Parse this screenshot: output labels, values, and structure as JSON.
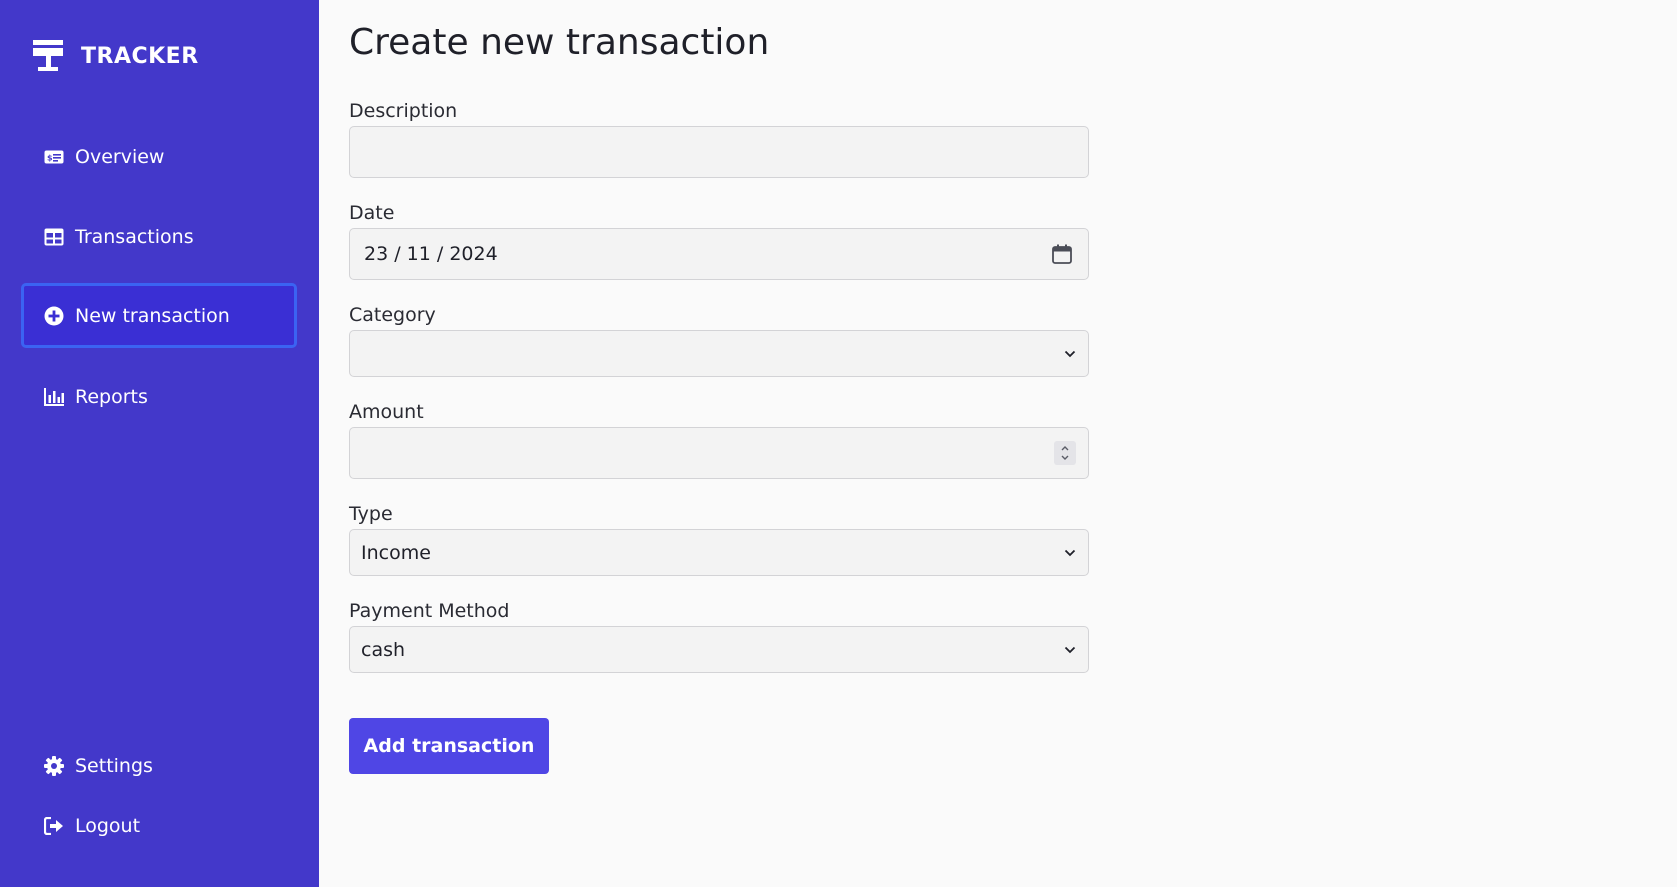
{
  "sidebar": {
    "brand": {
      "name": "TRACKER",
      "icon": "table-sign-icon"
    },
    "nav": [
      {
        "label": "Overview",
        "icon": "money-bill-icon",
        "active": false
      },
      {
        "label": "Transactions",
        "icon": "table-icon",
        "active": false
      },
      {
        "label": "New transaction",
        "icon": "plus-circle-icon",
        "active": true
      },
      {
        "label": "Reports",
        "icon": "chart-bar-icon",
        "active": false
      }
    ],
    "footer": [
      {
        "label": "Settings",
        "icon": "gear-icon"
      },
      {
        "label": "Logout",
        "icon": "logout-icon"
      }
    ],
    "colors": {
      "background": "#4338ca",
      "active_border": "#3b63f2"
    }
  },
  "main": {
    "title": "Create new transaction",
    "form": {
      "description": {
        "label": "Description",
        "value": ""
      },
      "date": {
        "label": "Date",
        "value": "23 / 11 / 2024",
        "icon": "calendar-icon"
      },
      "category": {
        "label": "Category",
        "selected": ""
      },
      "amount": {
        "label": "Amount",
        "value": ""
      },
      "type": {
        "label": "Type",
        "selected": "Income"
      },
      "payment_method": {
        "label": "Payment Method",
        "selected": "cash"
      }
    },
    "submit_label": "Add transaction",
    "colors": {
      "button": "#4f46e5"
    }
  }
}
